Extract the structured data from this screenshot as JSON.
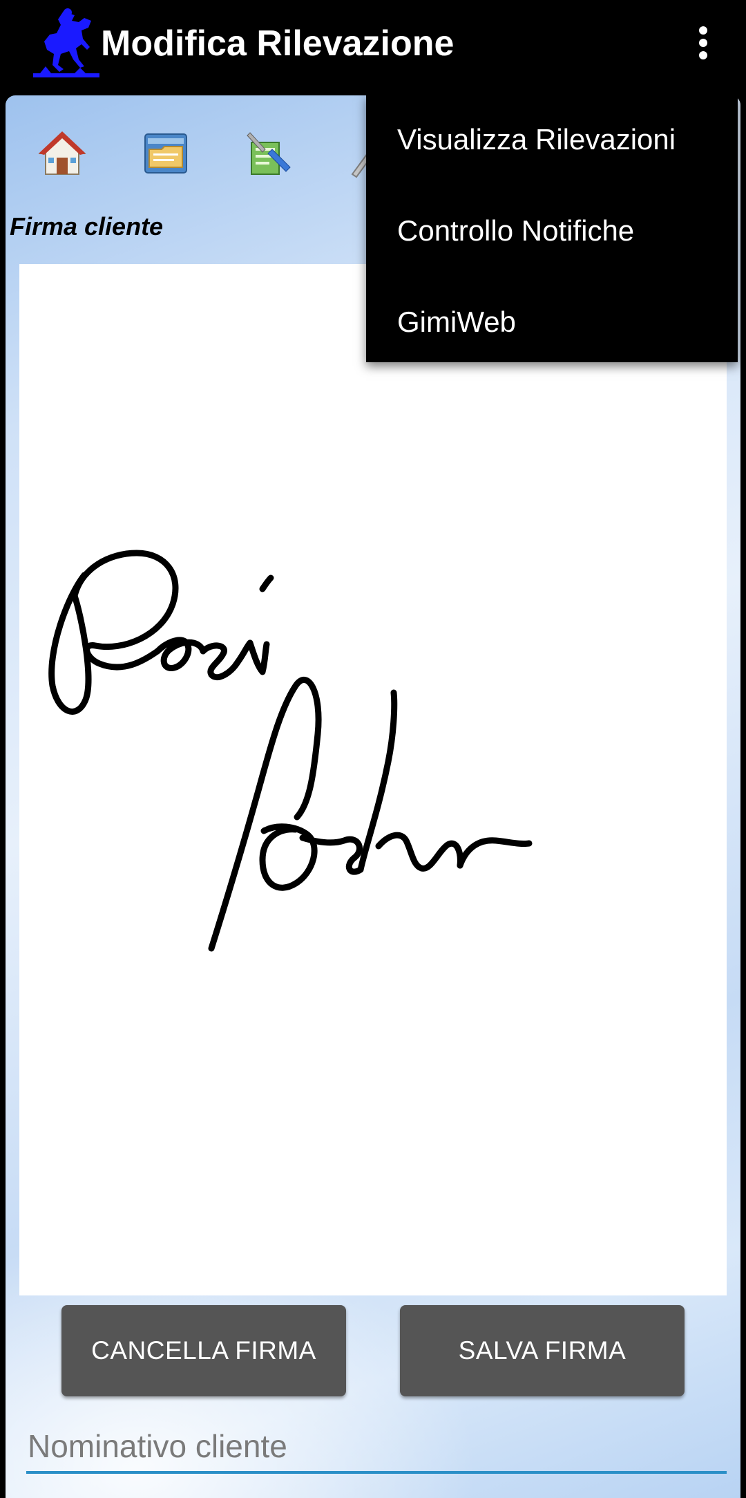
{
  "appbar": {
    "title": "Modifica Rilevazione",
    "logo_icon": "horse-rider-logo-icon",
    "overflow_icon": "more-vert-icon"
  },
  "toolbar": {
    "icons": [
      "home-icon",
      "archive-folder-icon",
      "edit-report-icon",
      "tools-icon"
    ]
  },
  "signature_section": {
    "label": "Firma cliente"
  },
  "buttons": {
    "clear_label": "CANCELLA FIRMA",
    "save_label": "SALVA FIRMA"
  },
  "customer_name": {
    "placeholder": "Nominativo cliente",
    "value": ""
  },
  "overflow_menu": {
    "items": [
      {
        "label": "Visualizza Rilevazioni"
      },
      {
        "label": "Controllo Notifiche"
      },
      {
        "label": "GimiWeb"
      }
    ]
  },
  "colors": {
    "appbar_bg": "#000000",
    "button_bg": "#555555",
    "input_underline": "#2a8fc7",
    "logo_blue": "#1a1aff"
  }
}
